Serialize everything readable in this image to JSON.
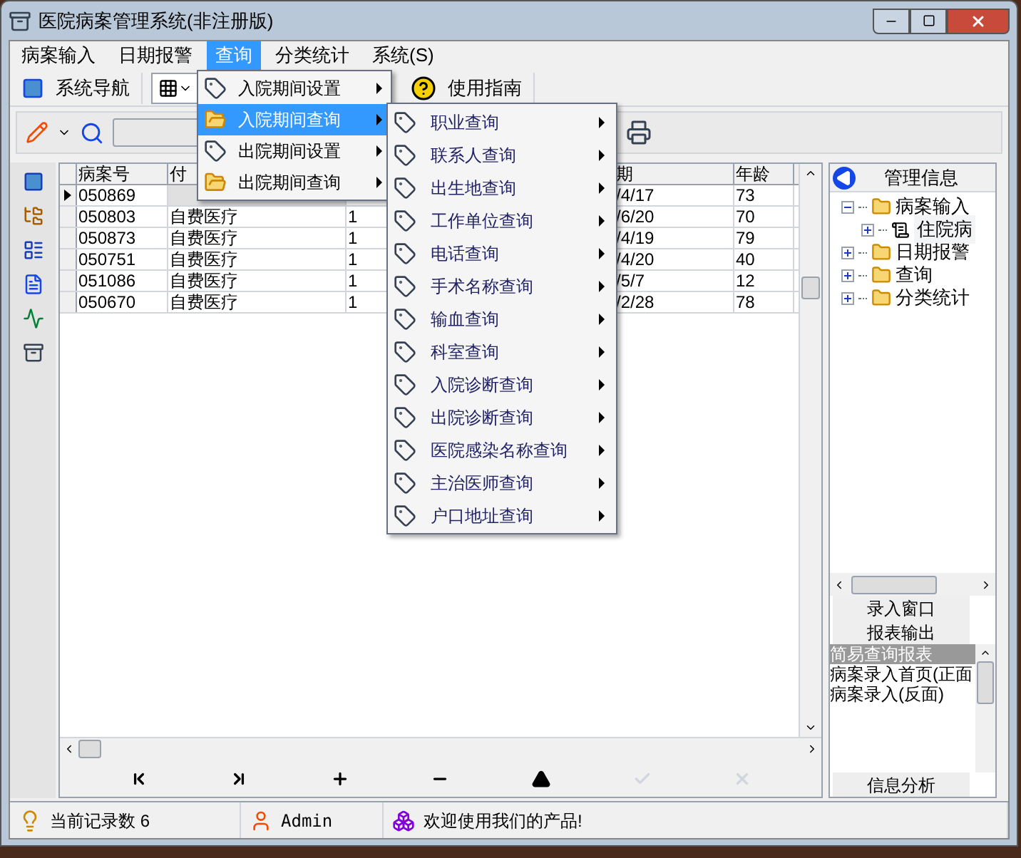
{
  "window": {
    "title": "医院病案管理系统(非注册版)"
  },
  "menu_bar": [
    {
      "label": "病案输入",
      "selected": false
    },
    {
      "label": "日期报警",
      "selected": false
    },
    {
      "label": "查询",
      "selected": true
    },
    {
      "label": "分类统计",
      "selected": false
    },
    {
      "label": "系统(S)",
      "selected": false
    }
  ],
  "toolbar": [
    {
      "label": "系统导航",
      "kind": "nav"
    },
    {
      "label": "使用指南",
      "kind": "help"
    }
  ],
  "query_menu": [
    {
      "label": "入院期间设置",
      "kind": "tag",
      "selected": false
    },
    {
      "label": "入院期间查询",
      "kind": "folder",
      "selected": true
    },
    {
      "label": "出院期间设置",
      "kind": "tag",
      "selected": false
    },
    {
      "label": "出院期间查询",
      "kind": "folder",
      "selected": false
    }
  ],
  "submenu": [
    "职业查询",
    "联系人查询",
    "出生地查询",
    "工作单位查询",
    "电话查询",
    "手术名称查询",
    "输血查询",
    "科室查询",
    "入院诊断查询",
    "出院诊断查询",
    "医院感染名称查询",
    "主治医师查询",
    "户口地址查询"
  ],
  "table": {
    "columns": [
      "病案号",
      "付",
      "",
      "期",
      "年龄"
    ],
    "rows": [
      {
        "cells": [
          "050869",
          "",
          "",
          "/4/17",
          "73"
        ],
        "current": true
      },
      {
        "cells": [
          "050803",
          "自费医疗",
          "1",
          "/6/20",
          "70"
        ],
        "current": false
      },
      {
        "cells": [
          "050873",
          "自费医疗",
          "1",
          "/4/19",
          "79"
        ],
        "current": false
      },
      {
        "cells": [
          "050751",
          "自费医疗",
          "1",
          "/4/20",
          "40"
        ],
        "current": false
      },
      {
        "cells": [
          "051086",
          "自费医疗",
          "1",
          "/5/7",
          "12"
        ],
        "current": false
      },
      {
        "cells": [
          "050670",
          "自费医疗",
          "1",
          "/2/28",
          "78"
        ],
        "current": false
      }
    ]
  },
  "navigator": [
    {
      "kind": "first",
      "disabled": false
    },
    {
      "kind": "last",
      "disabled": false
    },
    {
      "kind": "add",
      "disabled": false
    },
    {
      "kind": "delete",
      "disabled": false
    },
    {
      "kind": "up",
      "disabled": false
    },
    {
      "kind": "post",
      "disabled": true
    },
    {
      "kind": "cancel",
      "disabled": true
    }
  ],
  "tree": {
    "header": "管理信息",
    "items": [
      {
        "label": "病案输入",
        "expanded": true,
        "selected": false,
        "children": [
          {
            "label": "住院病",
            "expanded": false,
            "selected": true
          }
        ]
      },
      {
        "label": "日期报警",
        "expanded": false,
        "selected": false
      },
      {
        "label": "查询",
        "expanded": false,
        "selected": false
      },
      {
        "label": "分类统计",
        "expanded": false,
        "selected": false
      }
    ]
  },
  "outlook": {
    "sections": [
      "录入窗口",
      "报表输出"
    ],
    "items": [
      {
        "label": "简易查询报表",
        "selected": true
      },
      {
        "label": "病案录入首页(正面",
        "selected": false
      },
      {
        "label": "病案录入(反面)",
        "selected": false
      }
    ],
    "bottom_section": "信息分析"
  },
  "status_bar": [
    {
      "kind": "info",
      "text": "当前记录数 6"
    },
    {
      "kind": "user",
      "text": "Admin"
    },
    {
      "kind": "product",
      "text": "欢迎使用我们的产品!"
    }
  ]
}
